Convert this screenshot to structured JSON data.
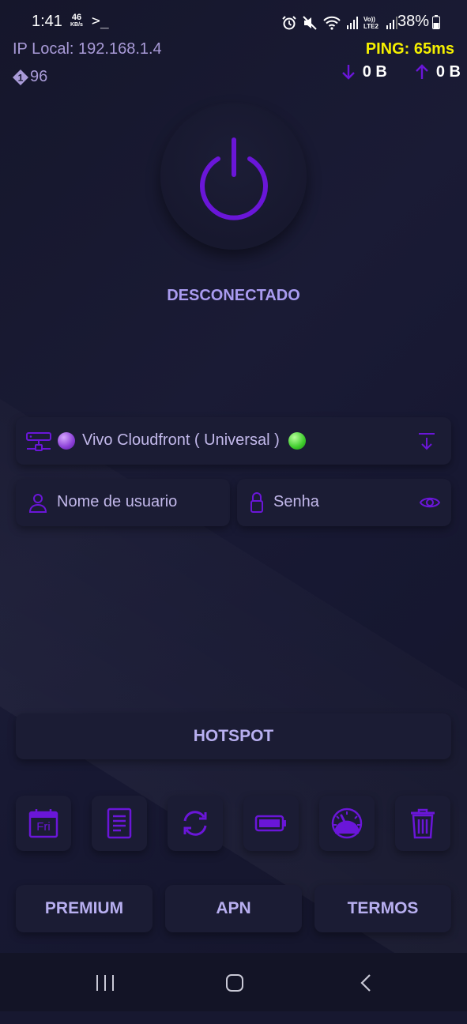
{
  "status_bar": {
    "time": "1:41",
    "net_speed_value": "46",
    "net_speed_unit": "KB/s",
    "terminal_glyph": ">_",
    "volte_label": "Vo)) LTE2",
    "battery": "38%"
  },
  "info": {
    "ip_local": "IP Local: 192.168.1.4",
    "version_number": "96",
    "ping": "PING: 65ms",
    "download": "0 B",
    "upload": "0 B"
  },
  "connection": {
    "status": "DESCONECTADO"
  },
  "server": {
    "label": "Vivo Cloudfront ( Universal )",
    "left_dot_color": "#9b55e0",
    "right_dot_color": "#3ecb2c"
  },
  "fields": {
    "username_placeholder": "Nome de usuario",
    "password_placeholder": "Senha"
  },
  "tools": {
    "calendar_day": "Fri",
    "icons": [
      "calendar-icon",
      "document-icon",
      "refresh-icon",
      "battery-icon",
      "speedometer-icon",
      "trash-icon"
    ]
  },
  "buttons": {
    "hotspot": "HOTSPOT",
    "premium": "PREMIUM",
    "apn": "APN",
    "termos": "TERMOS"
  },
  "colors": {
    "accent": "#6a16d8",
    "ping": "#f5f000",
    "label": "#a99bf0"
  }
}
